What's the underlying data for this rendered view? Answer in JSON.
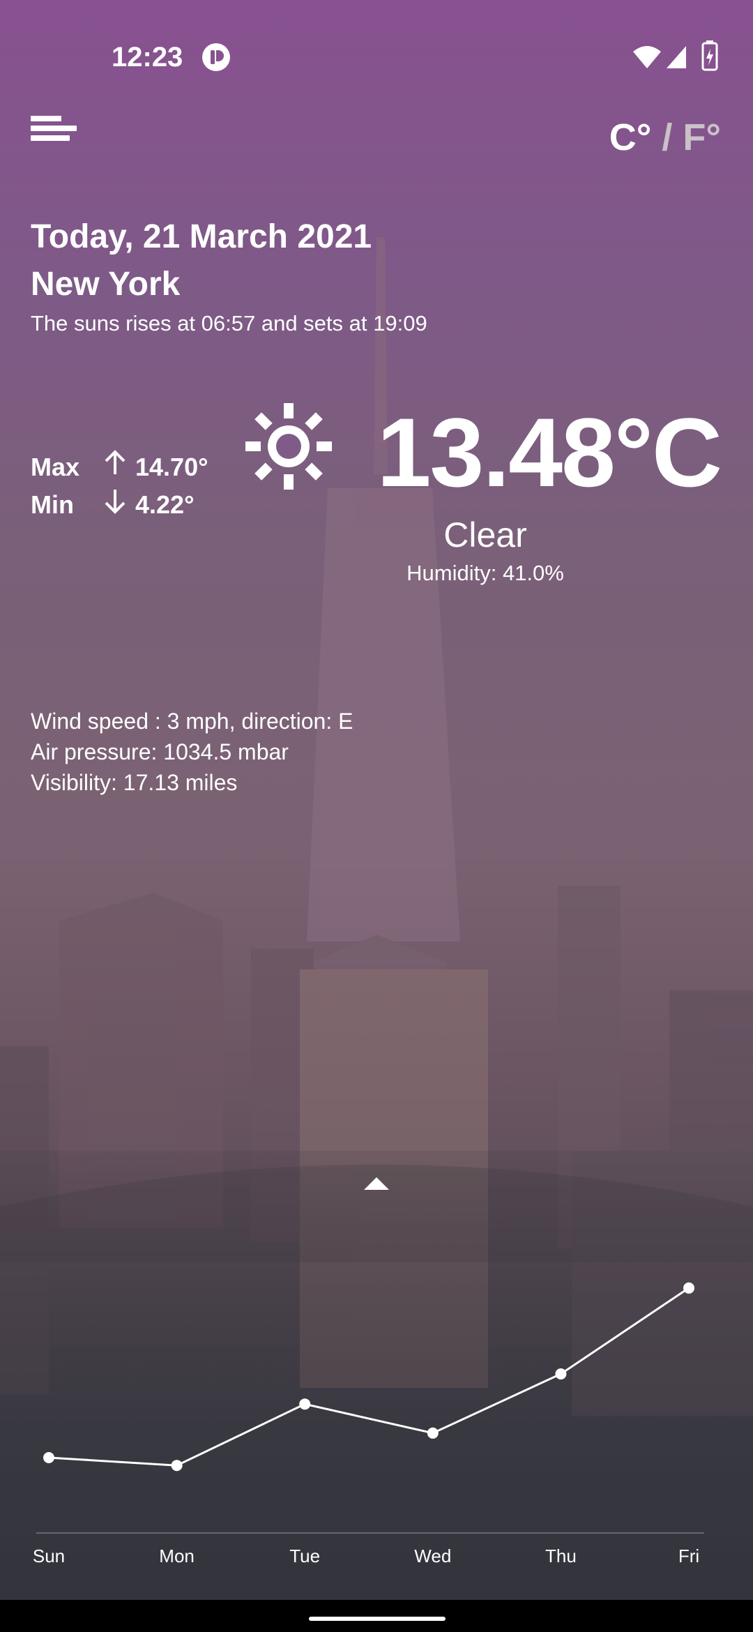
{
  "status_bar": {
    "time": "12:23"
  },
  "toolbar": {
    "unit_celsius": "C°",
    "unit_sep": " / ",
    "unit_fahrenheit": "F°"
  },
  "header": {
    "date": "Today, 21 March 2021",
    "city": "New York",
    "sun_text": "The suns rises at 06:57 and sets at 19:09"
  },
  "temps": {
    "max_label": "Max",
    "max_value": "14.70°",
    "min_label": "Min",
    "min_value": "4.22°",
    "current": "13.48°C",
    "condition": "Clear",
    "humidity": "Humidity: 41.0%"
  },
  "details": {
    "wind": "Wind speed : 3 mph, direction: E",
    "pressure": "Air pressure: 1034.5 mbar",
    "visibility": "Visibility: 17.13 miles"
  },
  "icons": [
    "menu-icon",
    "sun-icon",
    "wifi-icon",
    "signal-icon",
    "battery-icon",
    "chevron-up-icon"
  ],
  "colors": {
    "accent": "#885190",
    "text": "#ffffff"
  },
  "chart_data": {
    "type": "line",
    "categories": [
      "Sun",
      "Mon",
      "Tue",
      "Wed",
      "Thu",
      "Fri"
    ],
    "values": [
      2.5,
      1.8,
      7.3,
      4.7,
      10.0,
      17.7
    ],
    "ylim": [
      0,
      20
    ],
    "grid": false
  }
}
